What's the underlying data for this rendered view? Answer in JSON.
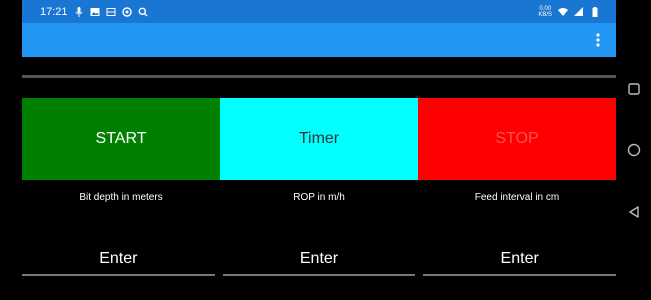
{
  "status_bar": {
    "time": "17:21",
    "net_speed_value": "0.00",
    "net_speed_unit": "KB/S",
    "left_icons": [
      "mic-icon",
      "image-icon",
      "screen-record-icon",
      "vpn-icon",
      "search-icon"
    ],
    "right_icons": [
      "wifi-icon",
      "signal-icon",
      "battery-icon"
    ]
  },
  "app_bar": {
    "overflow_icon": "more-vert-icon",
    "color": "#2196f3"
  },
  "buttons": {
    "start_label": "START",
    "timer_label": "Timer",
    "stop_label": "STOP",
    "start_color": "#008000",
    "timer_color": "#00ffff",
    "stop_color": "#ff0000"
  },
  "labels": {
    "bit_depth": "Bit depth in meters",
    "rop": "ROP in m/h",
    "feed_interval": "Feed interval in cm"
  },
  "inputs": {
    "bit_depth_placeholder": "Enter",
    "rop_placeholder": "Enter",
    "feed_interval_placeholder": "Enter"
  },
  "nav_bar": {
    "icons": [
      "recents-icon",
      "home-icon",
      "back-icon"
    ]
  }
}
